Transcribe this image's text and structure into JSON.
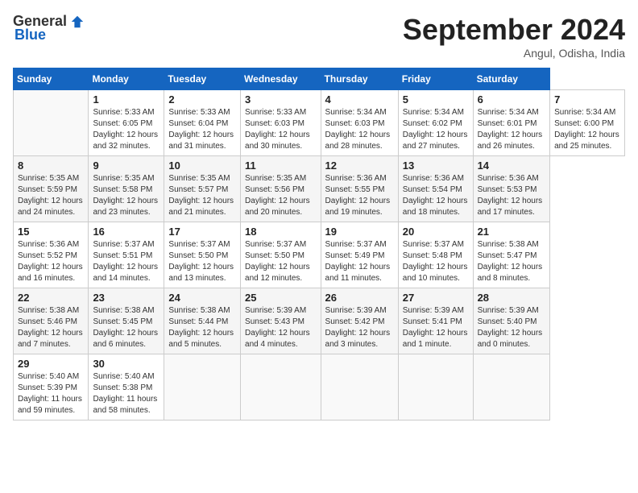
{
  "header": {
    "logo_general": "General",
    "logo_blue": "Blue",
    "month_title": "September 2024",
    "location": "Angul, Odisha, India"
  },
  "calendar": {
    "days_of_week": [
      "Sunday",
      "Monday",
      "Tuesday",
      "Wednesday",
      "Thursday",
      "Friday",
      "Saturday"
    ],
    "weeks": [
      [
        null,
        {
          "day": "1",
          "sunrise": "5:33 AM",
          "sunset": "6:05 PM",
          "daylight": "12 hours and 32 minutes."
        },
        {
          "day": "2",
          "sunrise": "5:33 AM",
          "sunset": "6:04 PM",
          "daylight": "12 hours and 31 minutes."
        },
        {
          "day": "3",
          "sunrise": "5:33 AM",
          "sunset": "6:03 PM",
          "daylight": "12 hours and 30 minutes."
        },
        {
          "day": "4",
          "sunrise": "5:34 AM",
          "sunset": "6:03 PM",
          "daylight": "12 hours and 28 minutes."
        },
        {
          "day": "5",
          "sunrise": "5:34 AM",
          "sunset": "6:02 PM",
          "daylight": "12 hours and 27 minutes."
        },
        {
          "day": "6",
          "sunrise": "5:34 AM",
          "sunset": "6:01 PM",
          "daylight": "12 hours and 26 minutes."
        },
        {
          "day": "7",
          "sunrise": "5:34 AM",
          "sunset": "6:00 PM",
          "daylight": "12 hours and 25 minutes."
        }
      ],
      [
        {
          "day": "8",
          "sunrise": "5:35 AM",
          "sunset": "5:59 PM",
          "daylight": "12 hours and 24 minutes."
        },
        {
          "day": "9",
          "sunrise": "5:35 AM",
          "sunset": "5:58 PM",
          "daylight": "12 hours and 23 minutes."
        },
        {
          "day": "10",
          "sunrise": "5:35 AM",
          "sunset": "5:57 PM",
          "daylight": "12 hours and 21 minutes."
        },
        {
          "day": "11",
          "sunrise": "5:35 AM",
          "sunset": "5:56 PM",
          "daylight": "12 hours and 20 minutes."
        },
        {
          "day": "12",
          "sunrise": "5:36 AM",
          "sunset": "5:55 PM",
          "daylight": "12 hours and 19 minutes."
        },
        {
          "day": "13",
          "sunrise": "5:36 AM",
          "sunset": "5:54 PM",
          "daylight": "12 hours and 18 minutes."
        },
        {
          "day": "14",
          "sunrise": "5:36 AM",
          "sunset": "5:53 PM",
          "daylight": "12 hours and 17 minutes."
        }
      ],
      [
        {
          "day": "15",
          "sunrise": "5:36 AM",
          "sunset": "5:52 PM",
          "daylight": "12 hours and 16 minutes."
        },
        {
          "day": "16",
          "sunrise": "5:37 AM",
          "sunset": "5:51 PM",
          "daylight": "12 hours and 14 minutes."
        },
        {
          "day": "17",
          "sunrise": "5:37 AM",
          "sunset": "5:50 PM",
          "daylight": "12 hours and 13 minutes."
        },
        {
          "day": "18",
          "sunrise": "5:37 AM",
          "sunset": "5:50 PM",
          "daylight": "12 hours and 12 minutes."
        },
        {
          "day": "19",
          "sunrise": "5:37 AM",
          "sunset": "5:49 PM",
          "daylight": "12 hours and 11 minutes."
        },
        {
          "day": "20",
          "sunrise": "5:37 AM",
          "sunset": "5:48 PM",
          "daylight": "12 hours and 10 minutes."
        },
        {
          "day": "21",
          "sunrise": "5:38 AM",
          "sunset": "5:47 PM",
          "daylight": "12 hours and 8 minutes."
        }
      ],
      [
        {
          "day": "22",
          "sunrise": "5:38 AM",
          "sunset": "5:46 PM",
          "daylight": "12 hours and 7 minutes."
        },
        {
          "day": "23",
          "sunrise": "5:38 AM",
          "sunset": "5:45 PM",
          "daylight": "12 hours and 6 minutes."
        },
        {
          "day": "24",
          "sunrise": "5:38 AM",
          "sunset": "5:44 PM",
          "daylight": "12 hours and 5 minutes."
        },
        {
          "day": "25",
          "sunrise": "5:39 AM",
          "sunset": "5:43 PM",
          "daylight": "12 hours and 4 minutes."
        },
        {
          "day": "26",
          "sunrise": "5:39 AM",
          "sunset": "5:42 PM",
          "daylight": "12 hours and 3 minutes."
        },
        {
          "day": "27",
          "sunrise": "5:39 AM",
          "sunset": "5:41 PM",
          "daylight": "12 hours and 1 minute."
        },
        {
          "day": "28",
          "sunrise": "5:39 AM",
          "sunset": "5:40 PM",
          "daylight": "12 hours and 0 minutes."
        }
      ],
      [
        {
          "day": "29",
          "sunrise": "5:40 AM",
          "sunset": "5:39 PM",
          "daylight": "11 hours and 59 minutes."
        },
        {
          "day": "30",
          "sunrise": "5:40 AM",
          "sunset": "5:38 PM",
          "daylight": "11 hours and 58 minutes."
        },
        null,
        null,
        null,
        null,
        null
      ]
    ]
  }
}
